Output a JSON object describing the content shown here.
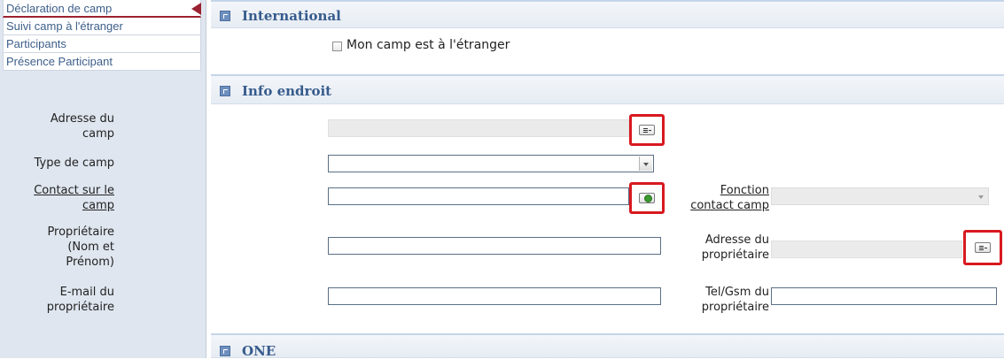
{
  "sidebar": {
    "items": [
      {
        "label": "Déclaration de camp",
        "active": true
      },
      {
        "label": "Suivi camp à l'étranger"
      },
      {
        "label": "Participants"
      },
      {
        "label": "Présence Participant"
      }
    ]
  },
  "sections": {
    "international": {
      "title": "International",
      "abroad_checkbox": {
        "label": "Mon camp est à l'étranger",
        "checked": false
      }
    },
    "info_endroit": {
      "title": "Info endroit",
      "adresse_camp": {
        "label_line1": "Adresse du",
        "label_line2": "camp",
        "value": ""
      },
      "type_camp": {
        "label": "Type de camp",
        "value": ""
      },
      "contact_camp": {
        "label_line1": "Contact sur le",
        "label_line2": "camp",
        "value": ""
      },
      "fonction_contact": {
        "label_line1": "Fonction",
        "label_line2": "contact camp",
        "value": ""
      },
      "proprietaire_nom": {
        "label_line1": "Propriétaire",
        "label_line2": "(Nom et",
        "label_line3": "Prénom)",
        "value": ""
      },
      "adresse_proprietaire": {
        "label_line1": "Adresse du",
        "label_line2": "propriétaire",
        "value": ""
      },
      "email_proprietaire": {
        "label_line1": "E-mail du",
        "label_line2": "propriétaire",
        "value": ""
      },
      "tel_proprietaire": {
        "label_line1": "Tel/Gsm du",
        "label_line2": "propriétaire",
        "value": ""
      }
    },
    "one": {
      "title": "ONE"
    }
  },
  "icons": {
    "address_lookup": "address-card-icon",
    "contact_lookup": "contact-lookup-icon",
    "collapse": "collapse-icon",
    "dropdown": "chevron-down-icon"
  },
  "colors": {
    "sidebar_bg": "#dfe6ef",
    "active_marker": "#9b2231",
    "section_title": "#365b8c",
    "highlight_red": "#d81920"
  }
}
